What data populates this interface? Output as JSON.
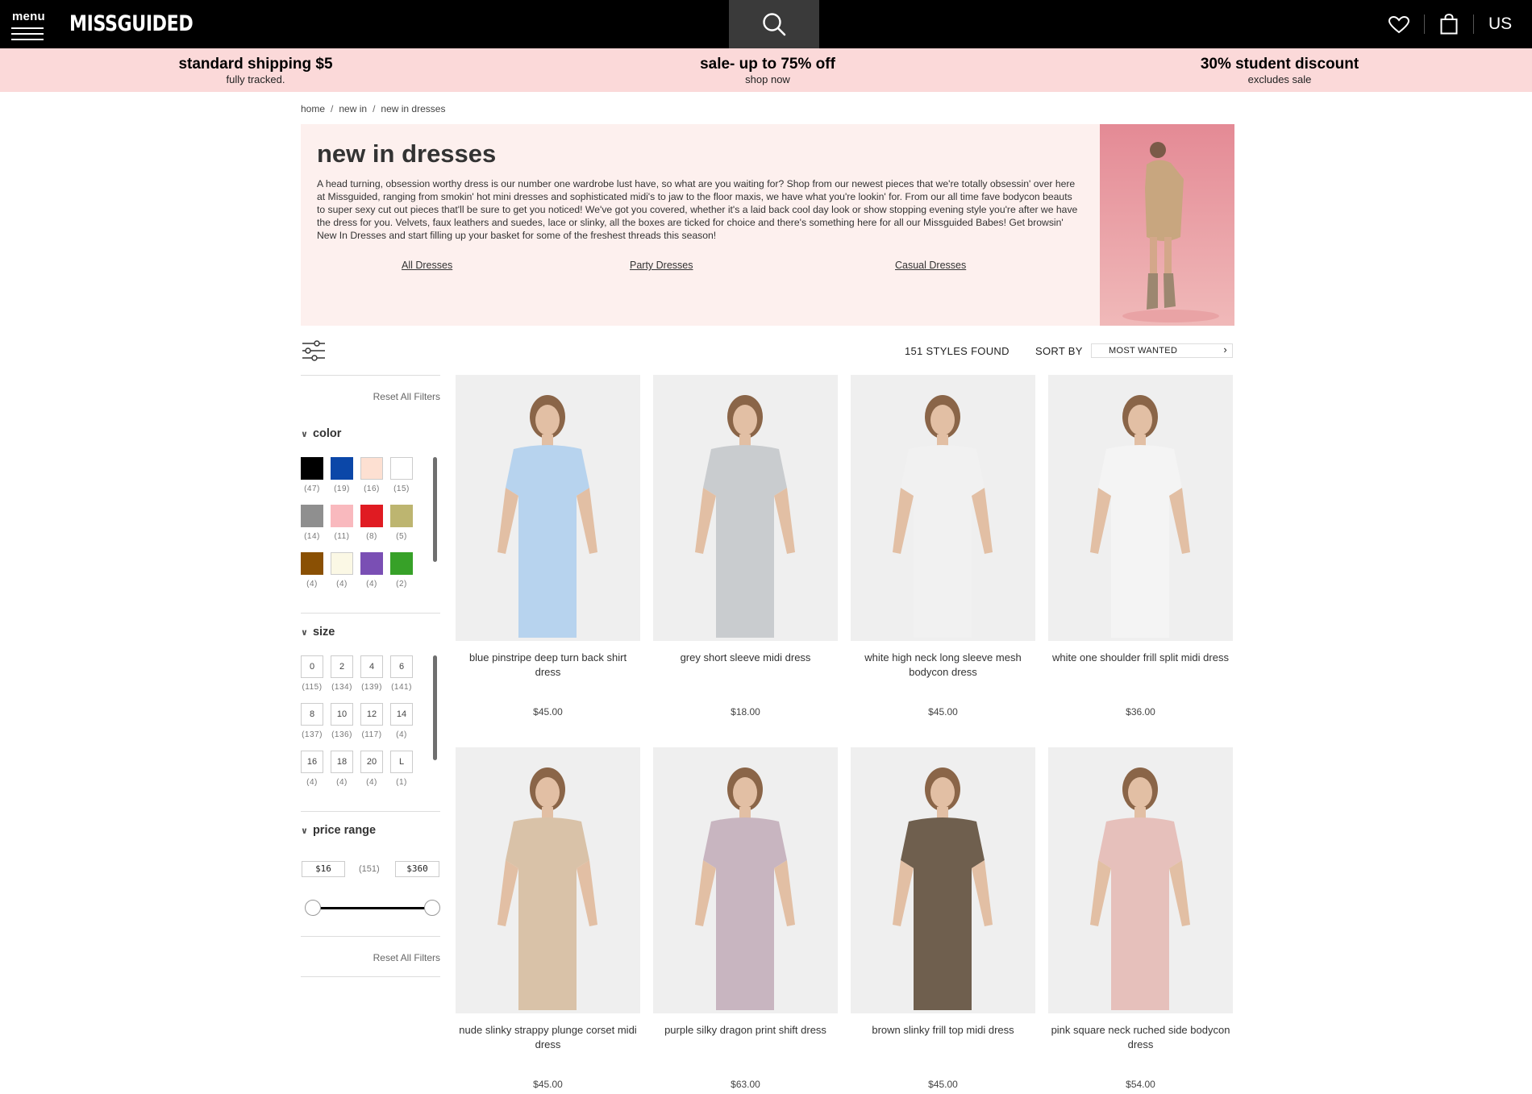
{
  "header": {
    "menu_label": "menu",
    "logo": "MISSGUIDED",
    "region": "US",
    "icons": {
      "menu": "hamburger-icon",
      "search": "search-icon",
      "wishlist": "heart-icon",
      "bag": "shopping-bag-icon"
    }
  },
  "promos": [
    {
      "title": "standard shipping $5",
      "subtitle": "fully tracked."
    },
    {
      "title": "sale- up to 75% off",
      "subtitle": "shop now"
    },
    {
      "title": "30% student discount",
      "subtitle": "excludes sale"
    }
  ],
  "breadcrumb": [
    "home",
    "new in",
    "new in dresses"
  ],
  "hero": {
    "title": "new in dresses",
    "description": "A head turning, obsession worthy dress is our number one wardrobe lust have, so what are you waiting for? Shop from our newest pieces that we're totally obsessin' over here at Missguided, ranging from smokin' hot mini dresses and sophisticated midi's to jaw to the floor maxis, we have what you're lookin' for. From our all time fave bodycon beauts to super sexy cut out pieces that'll be sure to get you noticed! We've got you covered, whether it's a laid back cool day look or show stopping evening style you're after we have the dress for you. Velvets, faux leathers and suedes, lace or slinky, all the boxes are ticked for choice and there's something here for all our Missguided Babes! Get browsin' New In Dresses and start filling up your basket for some of the freshest threads this season!",
    "links": [
      "All Dresses",
      "Party Dresses",
      "Casual Dresses"
    ]
  },
  "toolbar": {
    "styles_found": "151 STYLES FOUND",
    "sort_label": "SORT BY",
    "sort_value": "MOST WANTED"
  },
  "filters": {
    "reset_label": "Reset All Filters",
    "color": {
      "title": "color",
      "swatches": [
        {
          "color": "#000000",
          "count": "(47)"
        },
        {
          "color": "#0b47a8",
          "count": "(19)"
        },
        {
          "color": "#fde0d2",
          "count": "(16)"
        },
        {
          "color": "#ffffff",
          "count": "(15)"
        },
        {
          "color": "#8f8f8f",
          "count": "(14)"
        },
        {
          "color": "#f9b9be",
          "count": "(11)"
        },
        {
          "color": "#e01b22",
          "count": "(8)"
        },
        {
          "color": "#bdb570",
          "count": "(5)"
        },
        {
          "color": "#8a5004",
          "count": "(4)"
        },
        {
          "color": "#fbf8e5",
          "count": "(4)"
        },
        {
          "color": "#7a4fb4",
          "count": "(4)"
        },
        {
          "color": "#37a128",
          "count": "(2)"
        }
      ]
    },
    "size": {
      "title": "size",
      "options": [
        {
          "label": "0",
          "count": "(115)"
        },
        {
          "label": "2",
          "count": "(134)"
        },
        {
          "label": "4",
          "count": "(139)"
        },
        {
          "label": "6",
          "count": "(141)"
        },
        {
          "label": "8",
          "count": "(137)"
        },
        {
          "label": "10",
          "count": "(136)"
        },
        {
          "label": "12",
          "count": "(117)"
        },
        {
          "label": "14",
          "count": "(4)"
        },
        {
          "label": "16",
          "count": "(4)"
        },
        {
          "label": "18",
          "count": "(4)"
        },
        {
          "label": "20",
          "count": "(4)"
        },
        {
          "label": "L",
          "count": "(1)"
        }
      ]
    },
    "price": {
      "title": "price range",
      "min": "$16",
      "count": "(151)",
      "max": "$360"
    }
  },
  "products": [
    {
      "name": "blue pinstripe deep turn back shirt dress",
      "price": "$45.00",
      "color": "#b7d3ee"
    },
    {
      "name": "grey short sleeve midi dress",
      "price": "$18.00",
      "color": "#c9cccf"
    },
    {
      "name": "white high neck long sleeve mesh bodycon dress",
      "price": "$45.00",
      "color": "#f1f1f1"
    },
    {
      "name": "white one shoulder frill split midi dress",
      "price": "$36.00",
      "color": "#f4f4f4"
    },
    {
      "name": "nude slinky strappy plunge corset midi dress",
      "price": "$45.00",
      "color": "#d9c2a8"
    },
    {
      "name": "purple silky dragon print shift dress",
      "price": "$63.00",
      "color": "#c8b5c0"
    },
    {
      "name": "brown slinky frill top midi dress",
      "price": "$45.00",
      "color": "#6f5f4e"
    },
    {
      "name": "pink square neck ruched side bodycon dress",
      "price": "$54.00",
      "color": "#e6c0bb"
    }
  ]
}
